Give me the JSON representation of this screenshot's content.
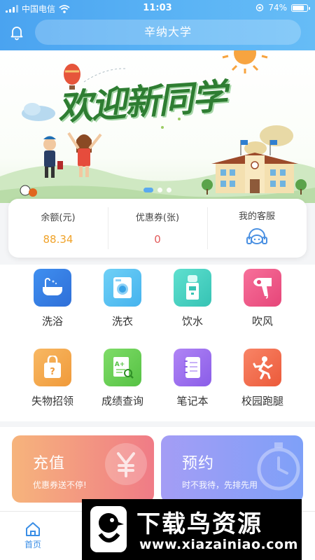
{
  "status_bar": {
    "carrier": "中国电信",
    "time": "11:03",
    "battery": "74%",
    "battery_level": 0.74
  },
  "header": {
    "title": "辛纳大学"
  },
  "banner": {
    "headline": "欢迎新同学",
    "slide_count": 3,
    "active_slide": 1
  },
  "info_card": {
    "balance_label": "余额(元)",
    "balance_value": "88.34",
    "coupon_label": "优惠券(张)",
    "coupon_value": "0",
    "service_label": "我的客服"
  },
  "services": [
    {
      "label": "洗浴",
      "icon": "bathtub-icon",
      "color": "#3b82e8"
    },
    {
      "label": "洗衣",
      "icon": "washing-machine-icon",
      "color": "#5cc3f2"
    },
    {
      "label": "饮水",
      "icon": "water-dispenser-icon",
      "color": "#4fd3c4"
    },
    {
      "label": "吹风",
      "icon": "hair-dryer-icon",
      "color": "#f05a8a"
    },
    {
      "label": "失物招领",
      "icon": "lost-found-icon",
      "color": "#f6a94c"
    },
    {
      "label": "成绩查询",
      "icon": "grade-query-icon",
      "color": "#6dd35a"
    },
    {
      "label": "笔记本",
      "icon": "notebook-icon",
      "color": "#9a6ef0"
    },
    {
      "label": "校园跑腿",
      "icon": "runner-icon",
      "color": "#f2684a"
    }
  ],
  "promos": {
    "recharge_title": "充值",
    "recharge_sub": "优惠券送不停!",
    "booking_title": "预约",
    "booking_sub": "时不我待，先排先用"
  },
  "nav": {
    "home_label": "首页"
  },
  "watermark": {
    "brand": "下载鸟资源",
    "url": "www.xiazainiao.com"
  }
}
